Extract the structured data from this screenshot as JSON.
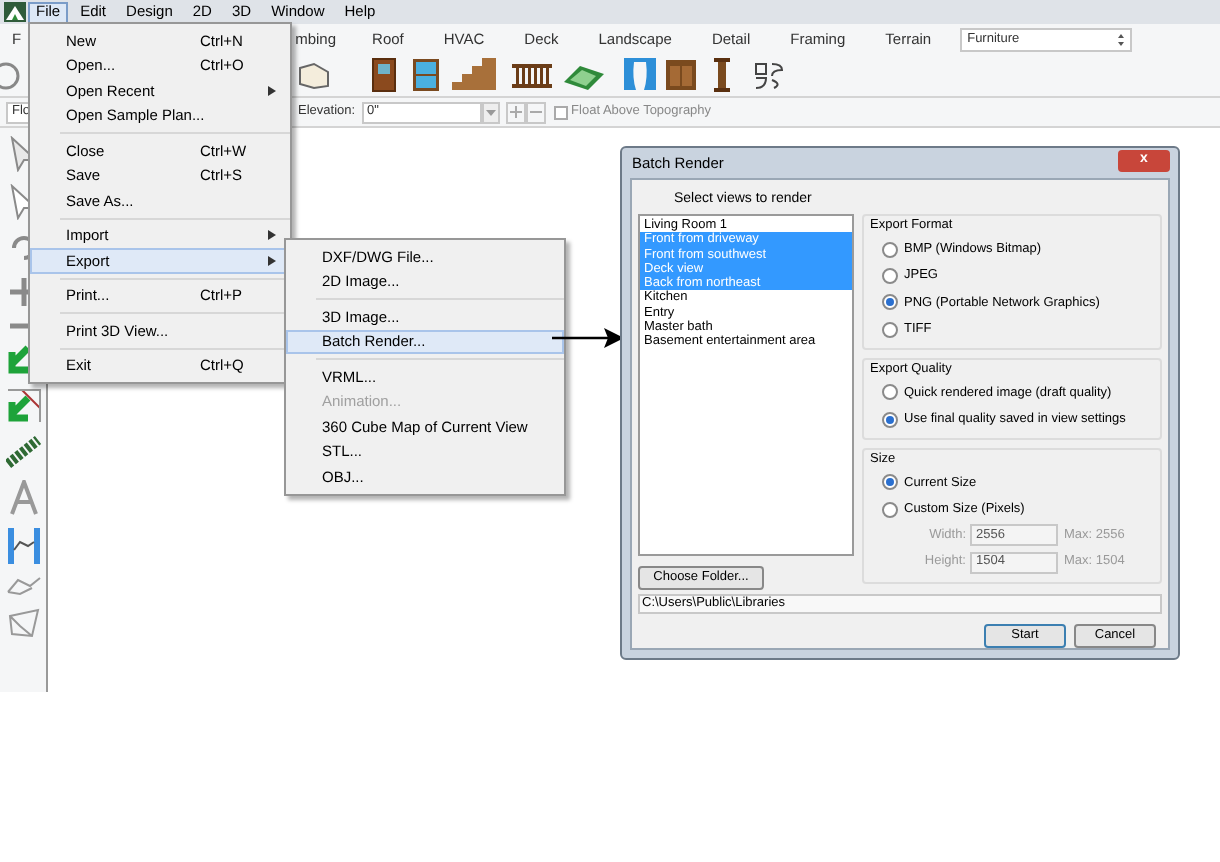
{
  "menubar": [
    {
      "label": "File",
      "selected": true
    },
    {
      "label": "Edit",
      "selected": false
    },
    {
      "label": "Design",
      "selected": false
    },
    {
      "label": "2D",
      "selected": false
    },
    {
      "label": "3D",
      "selected": false
    },
    {
      "label": "Window",
      "selected": false
    },
    {
      "label": "Help",
      "selected": false
    }
  ],
  "tabs": [
    {
      "label": "F"
    },
    {
      "label": "mbing"
    },
    {
      "label": "Roof"
    },
    {
      "label": "HVAC"
    },
    {
      "label": "Deck"
    },
    {
      "label": "Landscape"
    },
    {
      "label": "Detail"
    },
    {
      "label": "Framing"
    },
    {
      "label": "Terrain"
    }
  ],
  "library_select": {
    "value": "Furniture"
  },
  "property_bar": {
    "floor_label": "Flo",
    "elevation_label": "Elevation:",
    "elevation_value": "0\"",
    "float_label": "Float Above Topography",
    "float_checked": false
  },
  "file_menu": [
    [
      {
        "label": "New",
        "shortcut": "Ctrl+N",
        "submenu": false,
        "selected": false
      },
      {
        "label": "Open...",
        "shortcut": "Ctrl+O",
        "submenu": false,
        "selected": false
      },
      {
        "label": "Open Recent",
        "submenu": true,
        "selected": false
      },
      {
        "label": "Open Sample Plan...",
        "submenu": false,
        "selected": false
      }
    ],
    [
      {
        "label": "Close",
        "shortcut": "Ctrl+W",
        "submenu": false,
        "selected": false
      },
      {
        "label": "Save",
        "shortcut": "Ctrl+S",
        "submenu": false,
        "selected": false
      },
      {
        "label": "Save As...",
        "submenu": false,
        "selected": false
      }
    ],
    [
      {
        "label": "Import",
        "submenu": true,
        "selected": false
      },
      {
        "label": "Export",
        "submenu": true,
        "selected": true
      }
    ],
    [
      {
        "label": "Print...",
        "shortcut": "Ctrl+P",
        "submenu": false,
        "selected": false
      }
    ],
    [
      {
        "label": "Print 3D View...",
        "submenu": false,
        "selected": false
      }
    ],
    [
      {
        "label": "Exit",
        "shortcut": "Ctrl+Q",
        "submenu": false,
        "selected": false
      }
    ]
  ],
  "export_menu": [
    [
      {
        "label": "DXF/DWG File...",
        "disabled": false,
        "selected": false
      },
      {
        "label": "2D Image...",
        "disabled": false,
        "selected": false
      }
    ],
    [
      {
        "label": "3D Image...",
        "disabled": false,
        "selected": false
      },
      {
        "label": "Batch Render...",
        "disabled": false,
        "selected": true
      }
    ],
    [
      {
        "label": "VRML...",
        "disabled": false,
        "selected": false
      },
      {
        "label": "Animation...",
        "disabled": true,
        "selected": false
      },
      {
        "label": "360 Cube Map of Current View",
        "disabled": false,
        "selected": false
      },
      {
        "label": "STL...",
        "disabled": false,
        "selected": false
      },
      {
        "label": "OBJ...",
        "disabled": false,
        "selected": false
      }
    ]
  ],
  "dialog": {
    "title": "Batch Render",
    "close": "x",
    "list_label": "Select views to render",
    "views": [
      {
        "label": "Living Room 1",
        "selected": false
      },
      {
        "label": "Front from driveway",
        "selected": true
      },
      {
        "label": "Front from southwest",
        "selected": true
      },
      {
        "label": "Deck view",
        "selected": true
      },
      {
        "label": "Back from northeast",
        "selected": true
      },
      {
        "label": "Kitchen",
        "selected": false
      },
      {
        "label": "Entry",
        "selected": false
      },
      {
        "label": "Master bath",
        "selected": false
      },
      {
        "label": "Basement entertainment area",
        "selected": false
      }
    ],
    "groups": [
      {
        "label": "Export Format",
        "options": [
          {
            "label": "BMP (Windows Bitmap)",
            "selected": false
          },
          {
            "label": "JPEG",
            "selected": false
          },
          {
            "label": "PNG (Portable Network Graphics)",
            "selected": true
          },
          {
            "label": "TIFF",
            "selected": false
          }
        ]
      },
      {
        "label": "Export Quality",
        "options": [
          {
            "label": "Quick rendered image (draft quality)",
            "selected": false
          },
          {
            "label": "Use final quality saved in view settings",
            "selected": true
          }
        ]
      },
      {
        "label": "Size",
        "options": [
          {
            "label": "Current Size",
            "selected": true
          },
          {
            "label": "Custom Size (Pixels)",
            "selected": false
          }
        ],
        "fields": [
          {
            "label": "Width:",
            "value": "2556",
            "max": "Max: 2556"
          },
          {
            "label": "Height:",
            "value": "1504",
            "max": "Max: 1504"
          }
        ]
      }
    ],
    "choose_folder": "Choose Folder...",
    "path": "C:\\Users\\Public\\Libraries",
    "buttons": [
      "Start",
      "Cancel"
    ]
  }
}
